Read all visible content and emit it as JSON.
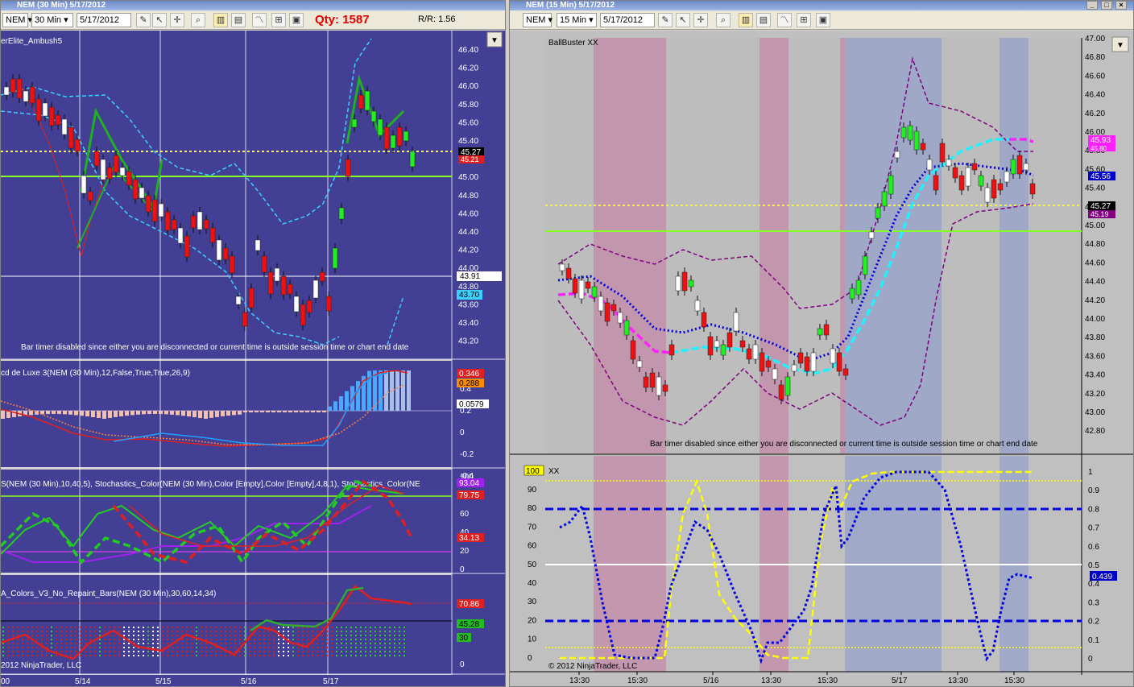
{
  "left_window": {
    "title": "NEM (30 Min)  5/17/2012",
    "instrument": "NEM",
    "interval": "30 Min",
    "date": "5/17/2012",
    "qty_label": "Qty:",
    "qty_value": "1587",
    "rr_label": "R/R:",
    "rr_value": "1.56",
    "price_panel": {
      "indicator": "erElite_Ambush5",
      "price_axis": [
        "46.40",
        "46.20",
        "46.00",
        "45.80",
        "45.60",
        "45.40",
        "45.20",
        "45.00",
        "44.80",
        "44.60",
        "44.40",
        "44.20",
        "44.00",
        "43.80",
        "43.60",
        "43.40",
        "43.20"
      ],
      "last_price": "45.27",
      "marker_red": "45.21",
      "crosshair_price": "43.91",
      "cyan_marker": "43.70",
      "bar_timer_text": "Bar timer disabled since either you are disconnected or current time is outside session time or chart end date"
    },
    "macd_panel": {
      "label": "cd de Luxe 3(NEM (30 Min),12,False,True,True,26,9)",
      "axis": [
        "0.4",
        "0.2",
        "0",
        "-0.2",
        "-0.4"
      ],
      "markers": [
        "0.346",
        "0.288",
        "0.0579"
      ]
    },
    "stoch_panel": {
      "label": "S(NEM (30 Min),10,40,5),  Stochastics_Color(NEM (30 Min),Color [Empty],Color [Empty],4,8,1),  Stochastics_Color(NE",
      "axis": [
        "100",
        "80",
        "60",
        "40",
        "20",
        "0"
      ],
      "markers": [
        "93.04",
        "79.75",
        "34.13"
      ]
    },
    "bars_panel": {
      "label": "A_Colors_V3_No_Repaint_Bars(NEM (30 Min),30,60,14,34)",
      "axis": [
        "0"
      ],
      "markers": [
        "70.86",
        "45.28",
        "30"
      ],
      "copyright": "2012 NinjaTrader, LLC"
    },
    "x_axis": [
      "5/14",
      "5/15",
      "5/16",
      "5/17"
    ],
    "x_axis_left": "00"
  },
  "right_window": {
    "title": "NEM (15 Min)  5/17/2012",
    "instrument": "NEM",
    "interval": "15 Min",
    "date": "5/17/2012",
    "price_panel": {
      "indicator": "BallBuster XX",
      "price_axis": [
        "47.00",
        "46.80",
        "46.60",
        "46.40",
        "46.20",
        "46.00",
        "45.80",
        "45.60",
        "45.40",
        "45.20",
        "45.00",
        "44.80",
        "44.60",
        "44.40",
        "44.20",
        "44.00",
        "43.80",
        "43.60",
        "43.40",
        "43.20",
        "43.00",
        "42.80"
      ],
      "markers": [
        "45.93",
        "45.80",
        "45.56",
        "45.27",
        "45.19"
      ],
      "bar_timer_text": "Bar timer disabled since either you are disconnected or current time is outside session time or chart end date"
    },
    "osc_panel": {
      "label": "XX",
      "badge": "100",
      "left_axis": [
        "90",
        "80",
        "70",
        "60",
        "50",
        "40",
        "30",
        "20",
        "10",
        "0"
      ],
      "right_axis": [
        "1",
        "0.9",
        "0.8",
        "0.7",
        "0.6",
        "0.5",
        "0.4",
        "0.3",
        "0.2",
        "0.1",
        "0"
      ],
      "marker": "0.439",
      "copyright": "© 2012 NinjaTrader, LLC"
    },
    "x_axis": [
      "13:30",
      "15:30",
      "5/16",
      "13:30",
      "15:30",
      "5/17",
      "13:30",
      "15:30"
    ]
  }
}
